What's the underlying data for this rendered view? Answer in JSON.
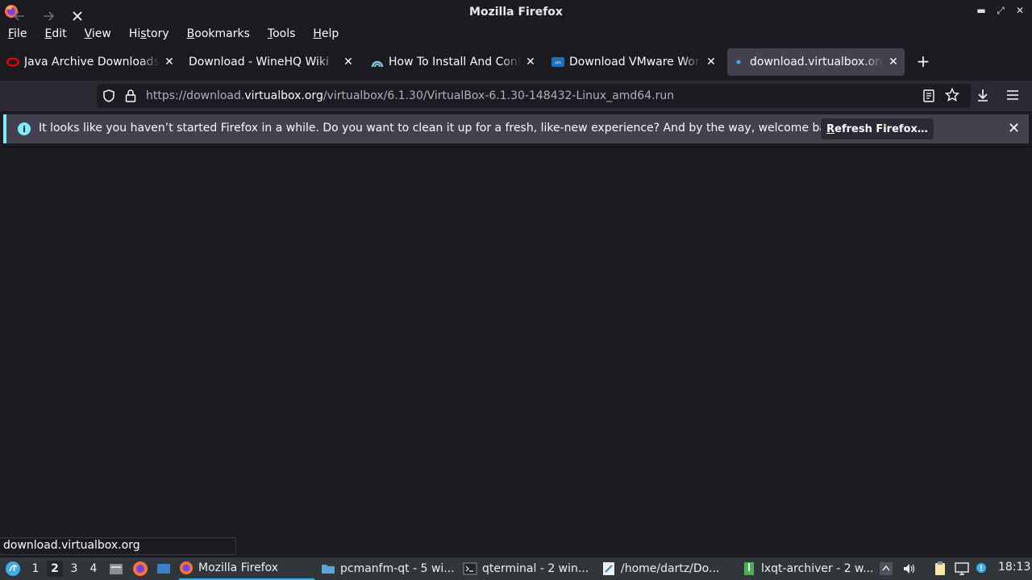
{
  "window": {
    "title": "Mozilla Firefox"
  },
  "menu": [
    {
      "label": "File",
      "accel": "F",
      "rest": "ile"
    },
    {
      "label": "Edit",
      "accel": "E",
      "rest": "dit"
    },
    {
      "label": "View",
      "accel": "V",
      "rest": "iew"
    },
    {
      "label": "History",
      "accel": "H",
      "rest": "istory"
    },
    {
      "label": "Bookmarks",
      "accel": "B",
      "rest": "ookmarks"
    },
    {
      "label": "Tools",
      "accel": "T",
      "rest": "ools"
    },
    {
      "label": "Help",
      "accel": "H",
      "rest": "elp"
    }
  ],
  "tabs": [
    {
      "label": "Java Archive Downloads",
      "icon": "oracle-icon"
    },
    {
      "label": "Download - WineHQ Wiki",
      "icon": "none"
    },
    {
      "label": "How To Install And Configure",
      "icon": "tecmint-icon"
    },
    {
      "label": "Download VMware Workstation",
      "icon": "vmware-icon"
    },
    {
      "label": "download.virtualbox.org/",
      "icon": "loading-icon",
      "active": true
    }
  ],
  "url": {
    "scheme": "https://download.",
    "host": "virtualbox.org",
    "path": "/virtualbox/6.1.30/VirtualBox-6.1.30-148432-Linux_amd64.run"
  },
  "notification": {
    "text": "It looks like you haven’t started Firefox in a while. Do you want to clean it up for a fresh, like-new experience? And by the way, welcome back!",
    "button": "Refresh Firefox…",
    "button_accel": "R",
    "button_rest": "efresh Firefox…"
  },
  "status": {
    "text": "download.virtualbox.org"
  },
  "taskbar": {
    "desktops": [
      "1",
      "2",
      "3",
      "4"
    ],
    "active_desktop": "2",
    "tasks": [
      {
        "label": "Mozilla Firefox",
        "active": true
      },
      {
        "label": "pcmanfm-qt - 5 wi..."
      },
      {
        "label": "qterminal - 2 win..."
      },
      {
        "label": "/home/dartz/Do..."
      },
      {
        "label": "lxqt-archiver - 2 w..."
      }
    ],
    "clock": "18:13"
  },
  "colors": {
    "accent": "#80ebff",
    "tab_active": "#42414d",
    "toolbar": "#2b2a33",
    "background": "#1c1b22",
    "taskbar": "#31363b"
  }
}
